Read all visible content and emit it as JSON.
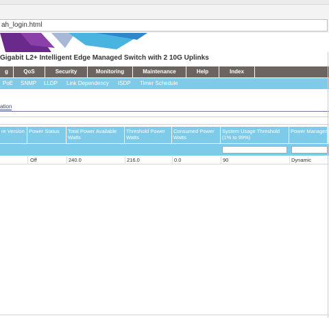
{
  "browser": {
    "address": "ah_login.html"
  },
  "page": {
    "title": "Gigabit L2+ Intelligent Edge Managed Switch with 2 10G Uplinks"
  },
  "menu": {
    "items": [
      {
        "label": "g"
      },
      {
        "label": "QoS"
      },
      {
        "label": "Security"
      },
      {
        "label": "Monitoring"
      },
      {
        "label": "Maintenance"
      },
      {
        "label": "Help"
      },
      {
        "label": "Index"
      }
    ]
  },
  "submenu": {
    "items": [
      {
        "label": "PoE"
      },
      {
        "label": "SNMP"
      },
      {
        "label": "LLDP"
      },
      {
        "label": "Link Dependency"
      },
      {
        "label": "ISDP"
      },
      {
        "label": "Timer Schedule"
      }
    ]
  },
  "tab": {
    "label": "ation"
  },
  "table": {
    "headers": [
      "re Version",
      "Power Status",
      "Total Power Available Watts",
      "Threshold Power Watts",
      "Consumed Power Watts",
      "System Usage Threshold (1% to 99%)",
      "Power Management"
    ],
    "row": [
      "",
      "Off",
      "240.0",
      "216.0",
      "0.0",
      "90",
      "Dynamic"
    ]
  },
  "colors": {
    "menubar": "#6b6461",
    "submenubar": "#7ecbe9",
    "banner_purple": "#6a2a8c",
    "banner_blue": "#49b4e0"
  }
}
